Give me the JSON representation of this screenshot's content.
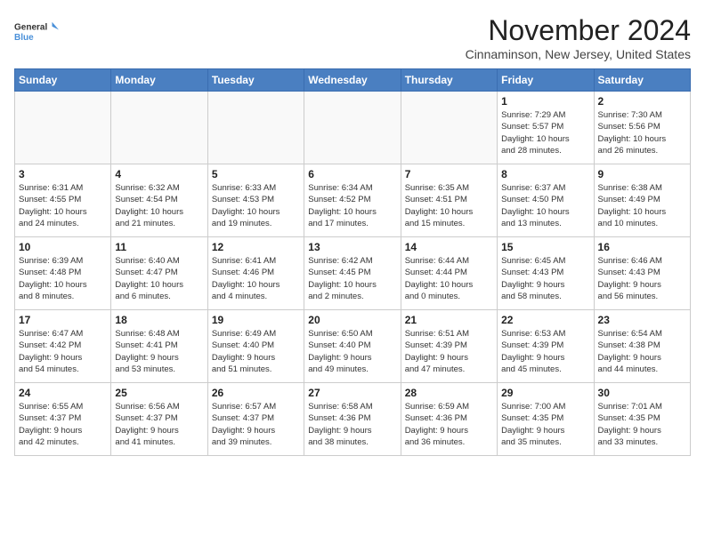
{
  "header": {
    "logo_line1": "General",
    "logo_line2": "Blue",
    "month_year": "November 2024",
    "location": "Cinnaminson, New Jersey, United States"
  },
  "weekdays": [
    "Sunday",
    "Monday",
    "Tuesday",
    "Wednesday",
    "Thursday",
    "Friday",
    "Saturday"
  ],
  "weeks": [
    [
      {
        "day": "",
        "info": ""
      },
      {
        "day": "",
        "info": ""
      },
      {
        "day": "",
        "info": ""
      },
      {
        "day": "",
        "info": ""
      },
      {
        "day": "",
        "info": ""
      },
      {
        "day": "1",
        "info": "Sunrise: 7:29 AM\nSunset: 5:57 PM\nDaylight: 10 hours\nand 28 minutes."
      },
      {
        "day": "2",
        "info": "Sunrise: 7:30 AM\nSunset: 5:56 PM\nDaylight: 10 hours\nand 26 minutes."
      }
    ],
    [
      {
        "day": "3",
        "info": "Sunrise: 6:31 AM\nSunset: 4:55 PM\nDaylight: 10 hours\nand 24 minutes."
      },
      {
        "day": "4",
        "info": "Sunrise: 6:32 AM\nSunset: 4:54 PM\nDaylight: 10 hours\nand 21 minutes."
      },
      {
        "day": "5",
        "info": "Sunrise: 6:33 AM\nSunset: 4:53 PM\nDaylight: 10 hours\nand 19 minutes."
      },
      {
        "day": "6",
        "info": "Sunrise: 6:34 AM\nSunset: 4:52 PM\nDaylight: 10 hours\nand 17 minutes."
      },
      {
        "day": "7",
        "info": "Sunrise: 6:35 AM\nSunset: 4:51 PM\nDaylight: 10 hours\nand 15 minutes."
      },
      {
        "day": "8",
        "info": "Sunrise: 6:37 AM\nSunset: 4:50 PM\nDaylight: 10 hours\nand 13 minutes."
      },
      {
        "day": "9",
        "info": "Sunrise: 6:38 AM\nSunset: 4:49 PM\nDaylight: 10 hours\nand 10 minutes."
      }
    ],
    [
      {
        "day": "10",
        "info": "Sunrise: 6:39 AM\nSunset: 4:48 PM\nDaylight: 10 hours\nand 8 minutes."
      },
      {
        "day": "11",
        "info": "Sunrise: 6:40 AM\nSunset: 4:47 PM\nDaylight: 10 hours\nand 6 minutes."
      },
      {
        "day": "12",
        "info": "Sunrise: 6:41 AM\nSunset: 4:46 PM\nDaylight: 10 hours\nand 4 minutes."
      },
      {
        "day": "13",
        "info": "Sunrise: 6:42 AM\nSunset: 4:45 PM\nDaylight: 10 hours\nand 2 minutes."
      },
      {
        "day": "14",
        "info": "Sunrise: 6:44 AM\nSunset: 4:44 PM\nDaylight: 10 hours\nand 0 minutes."
      },
      {
        "day": "15",
        "info": "Sunrise: 6:45 AM\nSunset: 4:43 PM\nDaylight: 9 hours\nand 58 minutes."
      },
      {
        "day": "16",
        "info": "Sunrise: 6:46 AM\nSunset: 4:43 PM\nDaylight: 9 hours\nand 56 minutes."
      }
    ],
    [
      {
        "day": "17",
        "info": "Sunrise: 6:47 AM\nSunset: 4:42 PM\nDaylight: 9 hours\nand 54 minutes."
      },
      {
        "day": "18",
        "info": "Sunrise: 6:48 AM\nSunset: 4:41 PM\nDaylight: 9 hours\nand 53 minutes."
      },
      {
        "day": "19",
        "info": "Sunrise: 6:49 AM\nSunset: 4:40 PM\nDaylight: 9 hours\nand 51 minutes."
      },
      {
        "day": "20",
        "info": "Sunrise: 6:50 AM\nSunset: 4:40 PM\nDaylight: 9 hours\nand 49 minutes."
      },
      {
        "day": "21",
        "info": "Sunrise: 6:51 AM\nSunset: 4:39 PM\nDaylight: 9 hours\nand 47 minutes."
      },
      {
        "day": "22",
        "info": "Sunrise: 6:53 AM\nSunset: 4:39 PM\nDaylight: 9 hours\nand 45 minutes."
      },
      {
        "day": "23",
        "info": "Sunrise: 6:54 AM\nSunset: 4:38 PM\nDaylight: 9 hours\nand 44 minutes."
      }
    ],
    [
      {
        "day": "24",
        "info": "Sunrise: 6:55 AM\nSunset: 4:37 PM\nDaylight: 9 hours\nand 42 minutes."
      },
      {
        "day": "25",
        "info": "Sunrise: 6:56 AM\nSunset: 4:37 PM\nDaylight: 9 hours\nand 41 minutes."
      },
      {
        "day": "26",
        "info": "Sunrise: 6:57 AM\nSunset: 4:37 PM\nDaylight: 9 hours\nand 39 minutes."
      },
      {
        "day": "27",
        "info": "Sunrise: 6:58 AM\nSunset: 4:36 PM\nDaylight: 9 hours\nand 38 minutes."
      },
      {
        "day": "28",
        "info": "Sunrise: 6:59 AM\nSunset: 4:36 PM\nDaylight: 9 hours\nand 36 minutes."
      },
      {
        "day": "29",
        "info": "Sunrise: 7:00 AM\nSunset: 4:35 PM\nDaylight: 9 hours\nand 35 minutes."
      },
      {
        "day": "30",
        "info": "Sunrise: 7:01 AM\nSunset: 4:35 PM\nDaylight: 9 hours\nand 33 minutes."
      }
    ]
  ]
}
